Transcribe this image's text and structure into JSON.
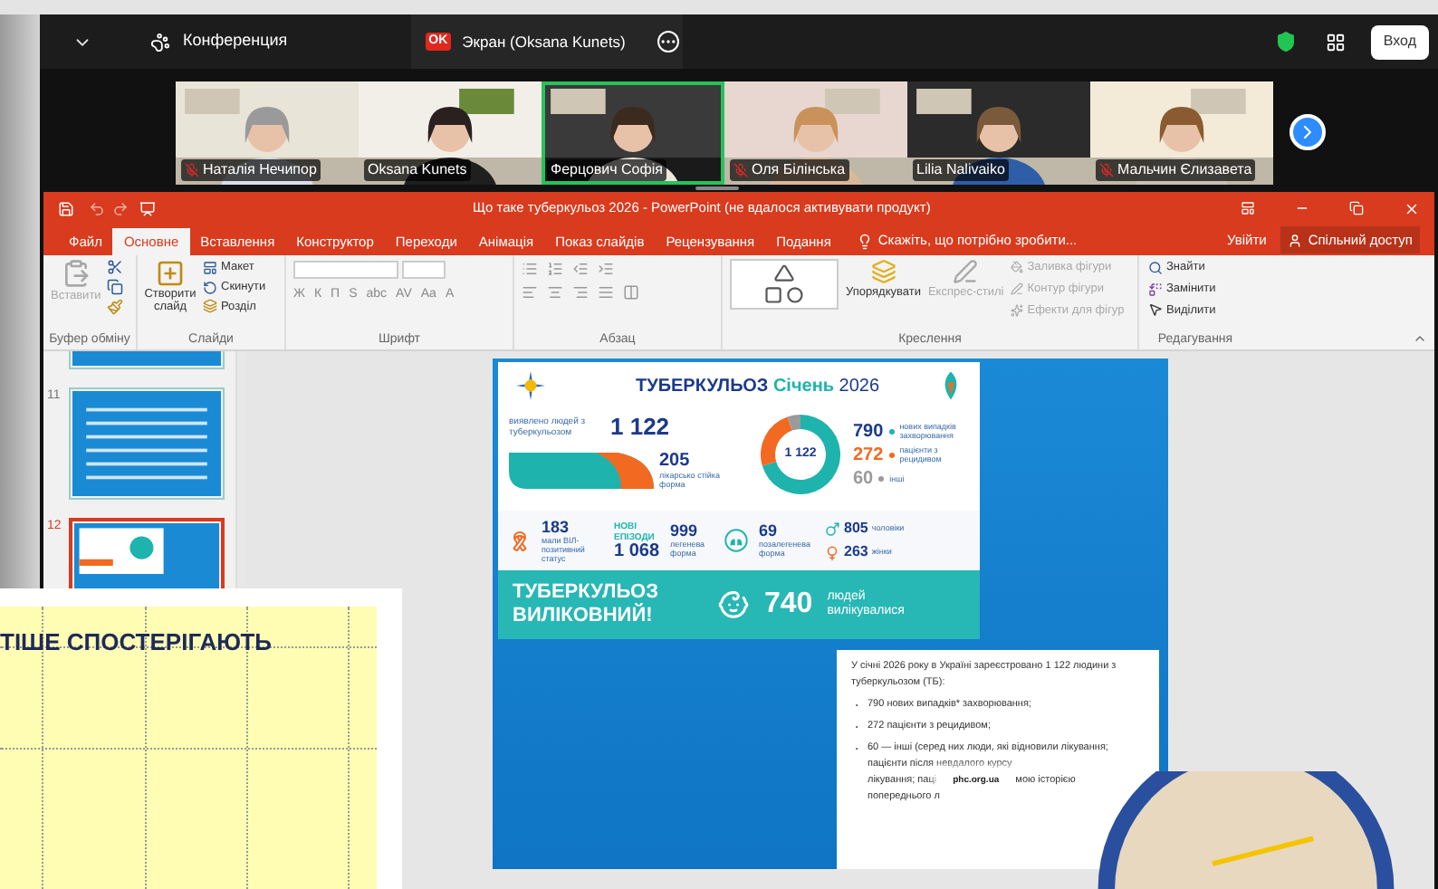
{
  "zoom": {
    "meeting_title": "Конференция",
    "share_badge": "OK",
    "share_title": "Экран (Oksana Kunets)",
    "login_button": "Вход",
    "participants": [
      {
        "name": "Наталія Нечипор",
        "muted": true,
        "selected": false
      },
      {
        "name": "Oksana Kunets",
        "muted": false,
        "selected": false
      },
      {
        "name": "Ферцович Софія",
        "muted": false,
        "selected": true
      },
      {
        "name": "Оля Білінська",
        "muted": true,
        "selected": false
      },
      {
        "name": "Lilia Nalivaiko",
        "muted": false,
        "selected": false
      },
      {
        "name": "Мальчин Єлизавета",
        "muted": true,
        "selected": false
      }
    ]
  },
  "powerpoint": {
    "title": "Що таке туберкульоз 2026 - PowerPoint (не вдалося активувати продукт)",
    "tabs": [
      {
        "label": "Файл",
        "selected": false
      },
      {
        "label": "Основне",
        "selected": true
      },
      {
        "label": "Вставлення",
        "selected": false
      },
      {
        "label": "Конструктор",
        "selected": false
      },
      {
        "label": "Переходи",
        "selected": false
      },
      {
        "label": "Анімація",
        "selected": false
      },
      {
        "label": "Показ слайдів",
        "selected": false
      },
      {
        "label": "Рецензування",
        "selected": false
      },
      {
        "label": "Подання",
        "selected": false
      }
    ],
    "tell_me": "Скажіть, що потрібно зробити...",
    "sign_in": "Увійти",
    "share": "Спільний доступ",
    "clipboard": {
      "label": "Буфер обміну",
      "paste": {
        "label": "Вставити",
        "disabled": true
      }
    },
    "slides": {
      "label": "Слайди",
      "new_slide": "Створити слайд",
      "layout": "Макет",
      "reset": "Скинути",
      "section": "Розділ"
    },
    "font": {
      "label": "Шрифт",
      "format_buttons": [
        "Ж",
        "К",
        "П",
        "S",
        "abc",
        "AV",
        "Aa",
        "A"
      ]
    },
    "paragraph": {
      "label": "Абзац"
    },
    "drawing": {
      "label": "Креслення",
      "arrange": {
        "label": "Упорядкувати",
        "disabled": false
      },
      "quick_styles": {
        "label": "Експрес-стилі",
        "disabled": true
      },
      "shape_options": [
        {
          "label": "Заливка фігури",
          "disabled": true
        },
        {
          "label": "Контур фігури",
          "disabled": true
        },
        {
          "label": "Ефекти для фігур",
          "disabled": true
        }
      ]
    },
    "editing": {
      "label": "Редагування",
      "find": "Знайти",
      "replace": "Замінити",
      "select": "Виділити"
    },
    "thumbnails": [
      {
        "selected": false
      },
      {
        "number": "11",
        "selected": false
      },
      {
        "number": "12",
        "selected": true
      }
    ],
    "slide": {
      "infographic": {
        "title": "ТУБЕРКУЛЬОЗ",
        "month": "Січень",
        "year": "2026",
        "detected_label": "виявлено людей з туберкульозом",
        "detected_value": "1 122",
        "resistant_value": "205",
        "resistant_label": "лікарсько стійка форма",
        "chart_data": {
          "type": "donut",
          "categories": [
            "нових випадків захворювання",
            "пацієнти з рецидивом",
            "інші"
          ],
          "series": [
            {
              "name": "1 122",
              "colors": [
                "#1fb3ad",
                "#f26a21",
                "#9a9a9a"
              ],
              "values": [
                790,
                272,
                60
              ]
            }
          ],
          "data_labels": true,
          "legend": "right"
        },
        "hiv_value": "183",
        "hiv_label": "мали ВІЛ-позитивний статус",
        "episodes_label": "НОВІ ЕПІЗОДИ",
        "episodes_value": "1 068",
        "pulmonary_value": "999",
        "pulmonary_label": "легенева форма",
        "extra_value": "69",
        "extra_label": "позалегенева форма",
        "men_value": "805",
        "men_label": "чоловіки",
        "women_value": "263",
        "women_label": "жінки",
        "banner_title": "ТУБЕРКУЛЬОЗ ВИЛІКОВНИЙ!",
        "cured_value": "740",
        "cured_label": "людей вилікувалися"
      },
      "text_box": {
        "intro": "У січні 2026 року в Україні зареєстровано 1 122 людини з туберкульозом (ТБ):",
        "bullets": [
          "790 нових випадків* захворювання;",
          "272 пацієнти з рецидивом;"
        ],
        "last_bullet": "60 — інші (серед них люди, які відновили лікування; пацієнти після невдалого курсу",
        "cut_before": "лікування; паці",
        "source": "phc.org.ua",
        "cut_after": "мою історією",
        "tail": "попереднього л"
      }
    }
  },
  "overlay_card": {
    "heading": "ТІШЕ СПОСТЕРІГАЮТЬ"
  }
}
